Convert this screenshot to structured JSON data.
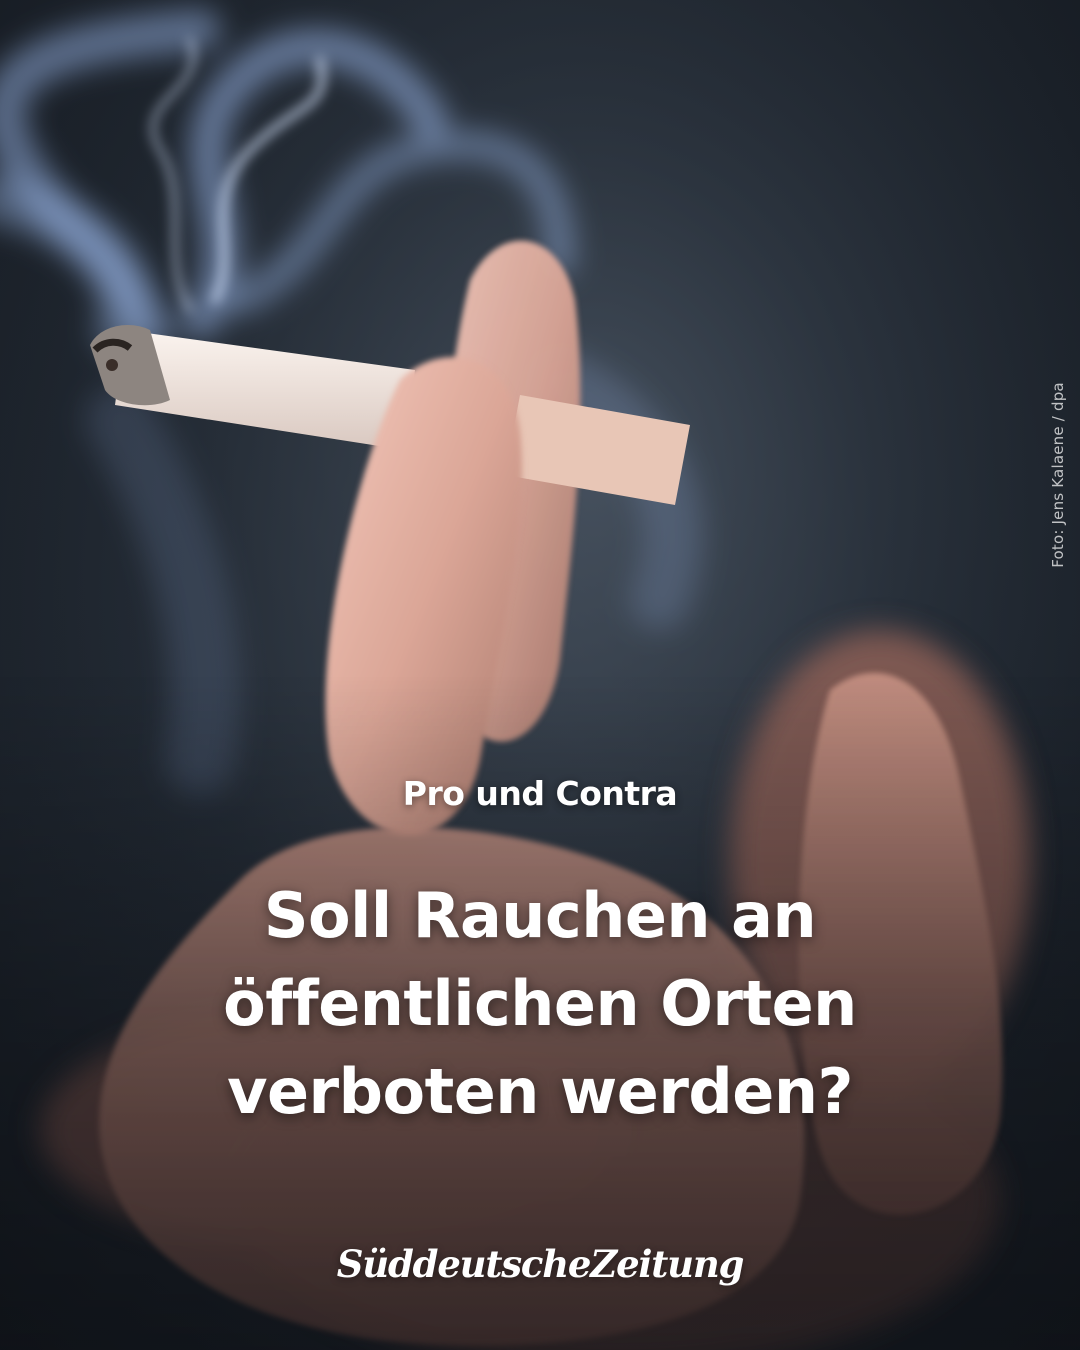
{
  "post": {
    "kicker": "Pro und Contra",
    "headline_lines": [
      "Soll Rauchen an",
      "öffentlichen Orten",
      "verboten werden?"
    ],
    "photo_credit": "Foto: Jens Kalaene / dpa",
    "brand_logo": "SüddeutscheZeitung"
  },
  "colors": {
    "text": "#ffffff",
    "background": "#1c232d",
    "smoke": "#9fc3ff",
    "skin": "#e7b3a3",
    "cigarette_paper": "#f2e6e0",
    "filter": "#e8c6b6"
  },
  "photo": {
    "subject": "hand holding a lit cigarette with smoke",
    "cigarette_icon": "cigarette-icon",
    "smoke_icon": "smoke-icon"
  }
}
